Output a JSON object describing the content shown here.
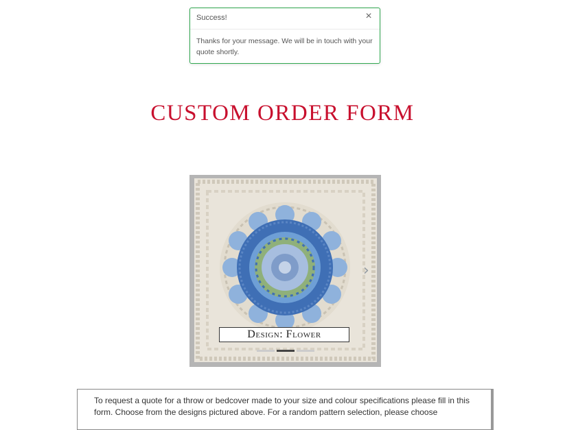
{
  "toast": {
    "title": "Success!",
    "close_icon": "×",
    "message": "Thanks for your message. We will be in touch with your quote shortly."
  },
  "page": {
    "title": "CUSTOM ORDER FORM"
  },
  "slider": {
    "caption": "Design: Flower",
    "next_icon": "›",
    "slide_count": 3,
    "active_slide": 2
  },
  "intro": {
    "text": "To request a quote for a throw or bedcover made to your size and colour specifications please fill in this form. Choose from the designs pictured above. For a random pattern selection, please choose"
  },
  "colors": {
    "title": "#c8102e",
    "toast_border": "#2fa84f"
  }
}
